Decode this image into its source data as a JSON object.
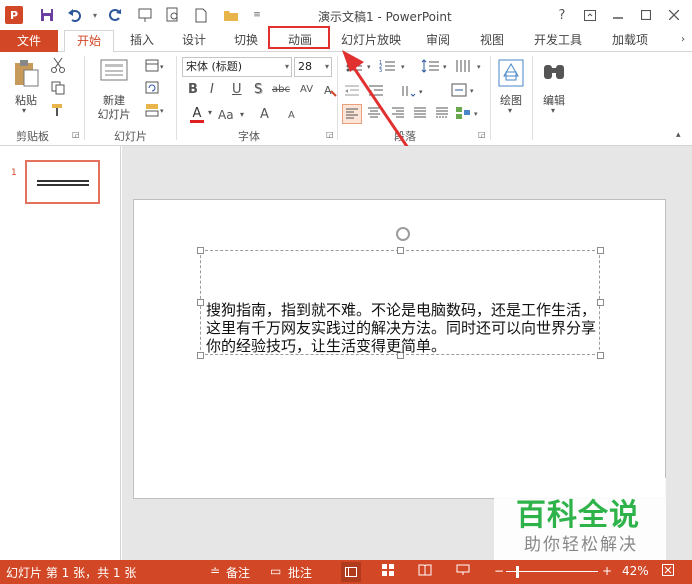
{
  "window": {
    "title": "演示文稿1 - PowerPoint",
    "logo": "P",
    "help": "?",
    "controls": [
      "restore-icon",
      "minimize-icon",
      "maximize-icon",
      "close-icon"
    ]
  },
  "tabs": [
    "文件",
    "开始",
    "插入",
    "设计",
    "切换",
    "动画",
    "幻灯片放映",
    "审阅",
    "视图",
    "开发工具",
    "加载项"
  ],
  "ribbon": {
    "clipboard": {
      "paste": "粘贴",
      "label": "剪贴板"
    },
    "slides": {
      "new_slide_line1": "新建",
      "new_slide_line2": "幻灯片",
      "label": "幻灯片"
    },
    "font": {
      "font_name": "宋体 (标题)",
      "font_size": "28",
      "label": "字体",
      "bold": "B",
      "italic": "I",
      "underline": "U",
      "shadow": "S",
      "strike": "abc",
      "spacing": "AV",
      "color": "A",
      "case": "Aa",
      "grow": "A",
      "shrink": "A"
    },
    "paragraph": {
      "label": "段落"
    },
    "drawing": {
      "label": "绘图"
    },
    "editing": {
      "label": "编辑"
    }
  },
  "slides_pane": {
    "slide_number": "1"
  },
  "slide": {
    "text": "搜狗指南，指到就不难。不论是电脑数码，还是工作生活，这里有千万网友实践过的解决方法。同时还可以向世界分享你的经验技巧，让生活变得更简单。"
  },
  "watermark": {
    "title": "百科全说",
    "subtitle": "助你轻松解决"
  },
  "status": {
    "slide_info": "幻灯片 第 1 张，共 1 张",
    "notes": "备注",
    "comments": "批注",
    "zoom": "42%"
  },
  "colors": {
    "accent": "#d24726",
    "highlight_box": "#e03030",
    "watermark_green": "#2db34a"
  }
}
